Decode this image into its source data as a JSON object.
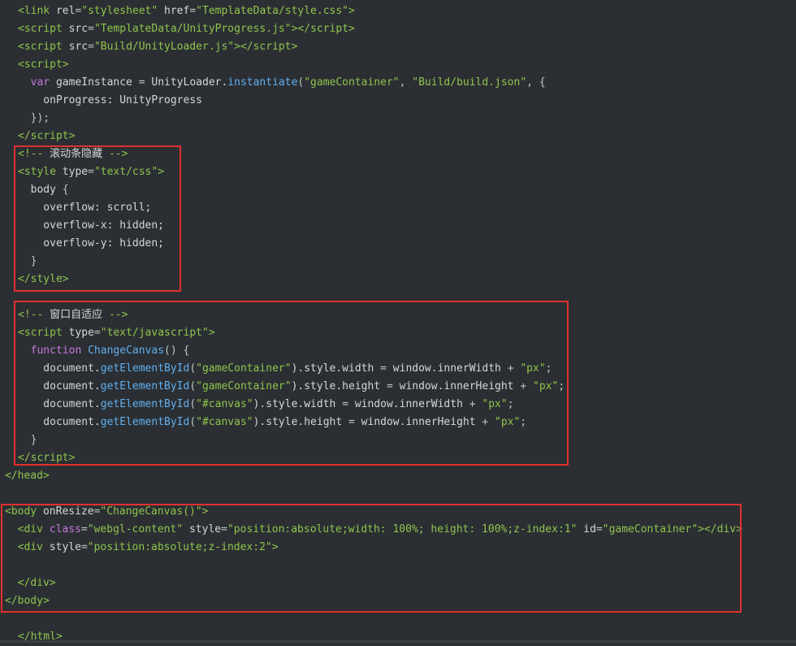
{
  "editor": {
    "highlight_color": "#e0312e",
    "lines": [
      {
        "tokens": [
          {
            "t": "<",
            "c": "t-tag"
          },
          {
            "t": "link",
            "c": "t-tag"
          },
          {
            "t": " rel",
            "c": "t-attr"
          },
          {
            "t": "=",
            "c": "t-punct"
          },
          {
            "t": "\"stylesheet\"",
            "c": "t-str"
          },
          {
            "t": " href",
            "c": "t-attr"
          },
          {
            "t": "=",
            "c": "t-punct"
          },
          {
            "t": "\"TemplateData/style.css\"",
            "c": "t-str"
          },
          {
            "t": ">",
            "c": "t-tag"
          }
        ]
      },
      {
        "tokens": [
          {
            "t": "<",
            "c": "t-tag"
          },
          {
            "t": "script",
            "c": "t-tag"
          },
          {
            "t": " src",
            "c": "t-attr"
          },
          {
            "t": "=",
            "c": "t-punct"
          },
          {
            "t": "\"TemplateData/UnityProgress.js\"",
            "c": "t-str"
          },
          {
            "t": "></",
            "c": "t-tag"
          },
          {
            "t": "script",
            "c": "t-tag"
          },
          {
            "t": ">",
            "c": "t-tag"
          }
        ]
      },
      {
        "tokens": [
          {
            "t": "<",
            "c": "t-tag"
          },
          {
            "t": "script",
            "c": "t-tag"
          },
          {
            "t": " src",
            "c": "t-attr"
          },
          {
            "t": "=",
            "c": "t-punct"
          },
          {
            "t": "\"Build/UnityLoader.js\"",
            "c": "t-str"
          },
          {
            "t": "></",
            "c": "t-tag"
          },
          {
            "t": "script",
            "c": "t-tag"
          },
          {
            "t": ">",
            "c": "t-tag"
          }
        ]
      },
      {
        "tokens": [
          {
            "t": "<",
            "c": "t-tag"
          },
          {
            "t": "script",
            "c": "t-tag"
          },
          {
            "t": ">",
            "c": "t-tag"
          }
        ]
      },
      {
        "tokens": [
          {
            "t": "  var",
            "c": "t-kw"
          },
          {
            "t": " gameInstance ",
            "c": "t-id"
          },
          {
            "t": "=",
            "c": "t-punct"
          },
          {
            "t": " UnityLoader.",
            "c": "t-id"
          },
          {
            "t": "instantiate",
            "c": "t-fn"
          },
          {
            "t": "(",
            "c": "t-punct"
          },
          {
            "t": "\"gameContainer\"",
            "c": "t-str"
          },
          {
            "t": ", ",
            "c": "t-punct"
          },
          {
            "t": "\"Build/build.json\"",
            "c": "t-str"
          },
          {
            "t": ", {",
            "c": "t-punct"
          }
        ]
      },
      {
        "tokens": [
          {
            "t": "    onProgress: UnityProgress",
            "c": "t-id"
          }
        ]
      },
      {
        "tokens": [
          {
            "t": "  });",
            "c": "t-punct"
          }
        ]
      },
      {
        "tokens": [
          {
            "t": "</",
            "c": "t-tag"
          },
          {
            "t": "script",
            "c": "t-tag"
          },
          {
            "t": ">",
            "c": "t-tag"
          }
        ]
      },
      {
        "tokens": [
          {
            "t": "<!-- ",
            "c": "t-cmt"
          },
          {
            "t": "滚动条隐藏",
            "c": "t-id"
          },
          {
            "t": " -->",
            "c": "t-cmt"
          }
        ]
      },
      {
        "tokens": [
          {
            "t": "<",
            "c": "t-tag"
          },
          {
            "t": "style",
            "c": "t-tag"
          },
          {
            "t": " type",
            "c": "t-attr"
          },
          {
            "t": "=",
            "c": "t-punct"
          },
          {
            "t": "\"text/css\"",
            "c": "t-str"
          },
          {
            "t": ">",
            "c": "t-tag"
          }
        ]
      },
      {
        "tokens": [
          {
            "t": "  body ",
            "c": "t-id"
          },
          {
            "t": "{",
            "c": "t-punct"
          }
        ]
      },
      {
        "tokens": [
          {
            "t": "    overflow: scroll;",
            "c": "t-id"
          }
        ]
      },
      {
        "tokens": [
          {
            "t": "    overflow-x: hidden;",
            "c": "t-id"
          }
        ]
      },
      {
        "tokens": [
          {
            "t": "    overflow-y: hidden;",
            "c": "t-id"
          }
        ]
      },
      {
        "tokens": [
          {
            "t": "  }",
            "c": "t-punct"
          }
        ]
      },
      {
        "tokens": [
          {
            "t": "</",
            "c": "t-tag"
          },
          {
            "t": "style",
            "c": "t-tag"
          },
          {
            "t": ">",
            "c": "t-tag"
          }
        ]
      },
      {
        "tokens": [
          {
            "t": "",
            "c": "t-id"
          }
        ]
      },
      {
        "tokens": [
          {
            "t": "<!-- ",
            "c": "t-cmt"
          },
          {
            "t": "窗口自适应",
            "c": "t-id"
          },
          {
            "t": " -->",
            "c": "t-cmt"
          }
        ]
      },
      {
        "tokens": [
          {
            "t": "<",
            "c": "t-tag"
          },
          {
            "t": "script",
            "c": "t-tag"
          },
          {
            "t": " type",
            "c": "t-attr"
          },
          {
            "t": "=",
            "c": "t-punct"
          },
          {
            "t": "\"text/javascript\"",
            "c": "t-str"
          },
          {
            "t": ">",
            "c": "t-tag"
          }
        ]
      },
      {
        "tokens": [
          {
            "t": "  function",
            "c": "t-kw"
          },
          {
            "t": " ChangeCanvas",
            "c": "t-fn"
          },
          {
            "t": "() {",
            "c": "t-punct"
          }
        ]
      },
      {
        "tokens": [
          {
            "t": "    document.",
            "c": "t-id"
          },
          {
            "t": "getElementById",
            "c": "t-fn"
          },
          {
            "t": "(",
            "c": "t-punct"
          },
          {
            "t": "\"gameContainer\"",
            "c": "t-str"
          },
          {
            "t": ").style.width ",
            "c": "t-id"
          },
          {
            "t": "=",
            "c": "t-punct"
          },
          {
            "t": " window.innerWidth ",
            "c": "t-id"
          },
          {
            "t": "+",
            "c": "t-punct"
          },
          {
            "t": " \"px\"",
            "c": "t-str"
          },
          {
            "t": ";",
            "c": "t-punct"
          }
        ]
      },
      {
        "tokens": [
          {
            "t": "    document.",
            "c": "t-id"
          },
          {
            "t": "getElementById",
            "c": "t-fn"
          },
          {
            "t": "(",
            "c": "t-punct"
          },
          {
            "t": "\"gameContainer\"",
            "c": "t-str"
          },
          {
            "t": ").style.height ",
            "c": "t-id"
          },
          {
            "t": "=",
            "c": "t-punct"
          },
          {
            "t": " window.innerHeight ",
            "c": "t-id"
          },
          {
            "t": "+",
            "c": "t-punct"
          },
          {
            "t": " \"px\"",
            "c": "t-str"
          },
          {
            "t": ";",
            "c": "t-punct"
          }
        ]
      },
      {
        "tokens": [
          {
            "t": "    document.",
            "c": "t-id"
          },
          {
            "t": "getElementById",
            "c": "t-fn"
          },
          {
            "t": "(",
            "c": "t-punct"
          },
          {
            "t": "\"#canvas\"",
            "c": "t-str"
          },
          {
            "t": ").style.width ",
            "c": "t-id"
          },
          {
            "t": "=",
            "c": "t-punct"
          },
          {
            "t": " window.innerWidth ",
            "c": "t-id"
          },
          {
            "t": "+",
            "c": "t-punct"
          },
          {
            "t": " \"px\"",
            "c": "t-str"
          },
          {
            "t": ";",
            "c": "t-punct"
          }
        ]
      },
      {
        "tokens": [
          {
            "t": "    document.",
            "c": "t-id"
          },
          {
            "t": "getElementById",
            "c": "t-fn"
          },
          {
            "t": "(",
            "c": "t-punct"
          },
          {
            "t": "\"#canvas\"",
            "c": "t-str"
          },
          {
            "t": ").style.height ",
            "c": "t-id"
          },
          {
            "t": "=",
            "c": "t-punct"
          },
          {
            "t": " window.innerHeight ",
            "c": "t-id"
          },
          {
            "t": "+",
            "c": "t-punct"
          },
          {
            "t": " \"px\"",
            "c": "t-str"
          },
          {
            "t": ";",
            "c": "t-punct"
          }
        ]
      },
      {
        "tokens": [
          {
            "t": "  }",
            "c": "t-punct"
          }
        ]
      },
      {
        "tokens": [
          {
            "t": "</",
            "c": "t-tag"
          },
          {
            "t": "script",
            "c": "t-tag"
          },
          {
            "t": ">",
            "c": "t-tag"
          }
        ]
      },
      {
        "tokens": [
          {
            "t": "</",
            "c": "t-tag"
          },
          {
            "t": "head",
            "c": "t-tag"
          },
          {
            "t": ">",
            "c": "t-tag"
          }
        ]
      },
      {
        "tokens": [
          {
            "t": "",
            "c": "t-id"
          }
        ]
      },
      {
        "tokens": [
          {
            "t": "<",
            "c": "t-tag"
          },
          {
            "t": "body",
            "c": "t-tag"
          },
          {
            "t": " onResize",
            "c": "t-attr"
          },
          {
            "t": "=",
            "c": "t-punct"
          },
          {
            "t": "\"ChangeCanvas()\"",
            "c": "t-str"
          },
          {
            "t": ">",
            "c": "t-tag"
          }
        ]
      },
      {
        "tokens": [
          {
            "t": "  <",
            "c": "t-tag"
          },
          {
            "t": "div",
            "c": "t-tag"
          },
          {
            "t": " class",
            "c": "t-kw"
          },
          {
            "t": "=",
            "c": "t-punct"
          },
          {
            "t": "\"webgl-content\"",
            "c": "t-str"
          },
          {
            "t": " style",
            "c": "t-attr"
          },
          {
            "t": "=",
            "c": "t-punct"
          },
          {
            "t": "\"position:absolute;width: 100%; height: 100%;z-index:1\"",
            "c": "t-str"
          },
          {
            "t": " id",
            "c": "t-attr"
          },
          {
            "t": "=",
            "c": "t-punct"
          },
          {
            "t": "\"gameContainer\"",
            "c": "t-str"
          },
          {
            "t": "></",
            "c": "t-tag"
          },
          {
            "t": "div",
            "c": "t-tag"
          },
          {
            "t": ">",
            "c": "t-tag"
          }
        ]
      },
      {
        "tokens": [
          {
            "t": "  <",
            "c": "t-tag"
          },
          {
            "t": "div",
            "c": "t-tag"
          },
          {
            "t": " style",
            "c": "t-attr"
          },
          {
            "t": "=",
            "c": "t-punct"
          },
          {
            "t": "\"position:absolute;z-index:2\"",
            "c": "t-str"
          },
          {
            "t": ">",
            "c": "t-tag"
          }
        ]
      },
      {
        "tokens": [
          {
            "t": "",
            "c": "t-id"
          }
        ]
      },
      {
        "tokens": [
          {
            "t": "  </",
            "c": "t-tag"
          },
          {
            "t": "div",
            "c": "t-tag"
          },
          {
            "t": ">",
            "c": "t-tag"
          }
        ]
      },
      {
        "tokens": [
          {
            "t": "</",
            "c": "t-tag"
          },
          {
            "t": "body",
            "c": "t-tag"
          },
          {
            "t": ">",
            "c": "t-tag"
          }
        ]
      },
      {
        "tokens": [
          {
            "t": "",
            "c": "t-id"
          }
        ]
      },
      {
        "tokens": [
          {
            "t": "</",
            "c": "t-tag"
          },
          {
            "t": "html",
            "c": "t-tag"
          },
          {
            "t": ">",
            "c": "t-tag"
          }
        ]
      }
    ]
  }
}
